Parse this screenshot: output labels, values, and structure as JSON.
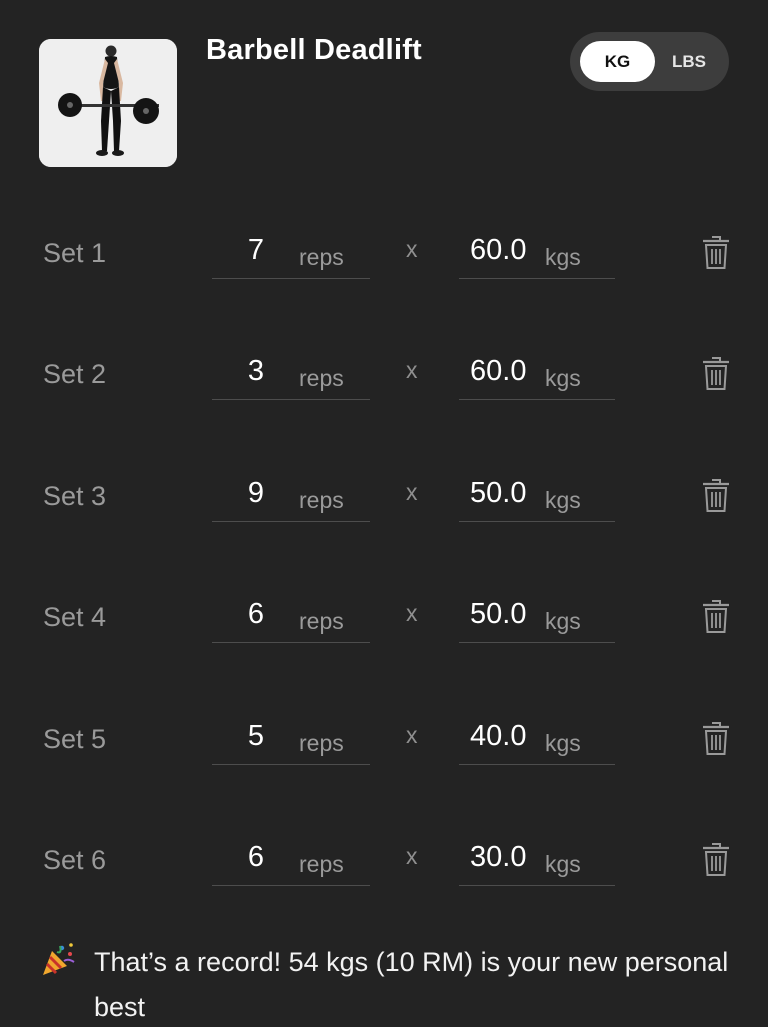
{
  "exercise": {
    "title": "Barbell Deadlift",
    "thumbnail_icon": "deadlift-illustration"
  },
  "units": {
    "kg_label": "KG",
    "lbs_label": "LBS",
    "selected": "KG"
  },
  "sets": [
    {
      "label": "Set 1",
      "reps": "7",
      "reps_unit": "reps",
      "times": "x",
      "weight": "60.0",
      "weight_unit": "kgs"
    },
    {
      "label": "Set 2",
      "reps": "3",
      "reps_unit": "reps",
      "times": "x",
      "weight": "60.0",
      "weight_unit": "kgs"
    },
    {
      "label": "Set 3",
      "reps": "9",
      "reps_unit": "reps",
      "times": "x",
      "weight": "50.0",
      "weight_unit": "kgs"
    },
    {
      "label": "Set 4",
      "reps": "6",
      "reps_unit": "reps",
      "times": "x",
      "weight": "50.0",
      "weight_unit": "kgs"
    },
    {
      "label": "Set 5",
      "reps": "5",
      "reps_unit": "reps",
      "times": "x",
      "weight": "40.0",
      "weight_unit": "kgs"
    },
    {
      "label": "Set 6",
      "reps": "6",
      "reps_unit": "reps",
      "times": "x",
      "weight": "30.0",
      "weight_unit": "kgs"
    }
  ],
  "record": {
    "icon": "party-popper-icon",
    "message": "That’s a record! 54 kgs (10 RM) is your new personal best"
  },
  "colors": {
    "background": "#232323",
    "toggle_track": "#3d3d3d",
    "muted_text": "#9a9a9a",
    "divider": "#4d4d4d"
  }
}
